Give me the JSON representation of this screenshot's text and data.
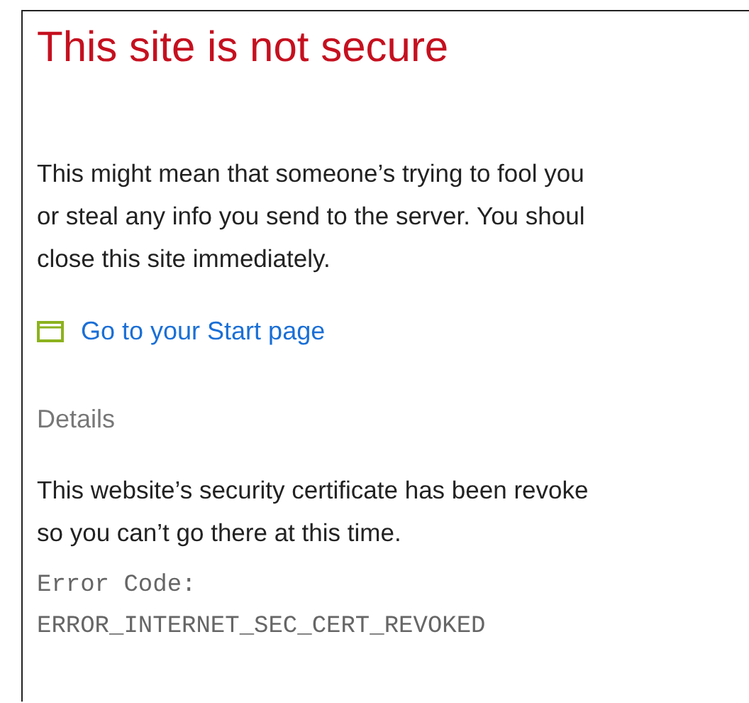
{
  "title": "This site is not secure",
  "warning_lines": [
    "This might mean that someone’s trying to fool you",
    "or steal any info you send to the server. You shoul",
    "close this site immediately."
  ],
  "start_link": {
    "label": "Go to your Start page"
  },
  "details_heading": "Details",
  "details_lines": [
    "This website’s security certificate has been revoke",
    "so you can’t go there at this time."
  ],
  "error_code_lines": [
    "Error Code:",
    "ERROR_INTERNET_SEC_CERT_REVOKED"
  ]
}
